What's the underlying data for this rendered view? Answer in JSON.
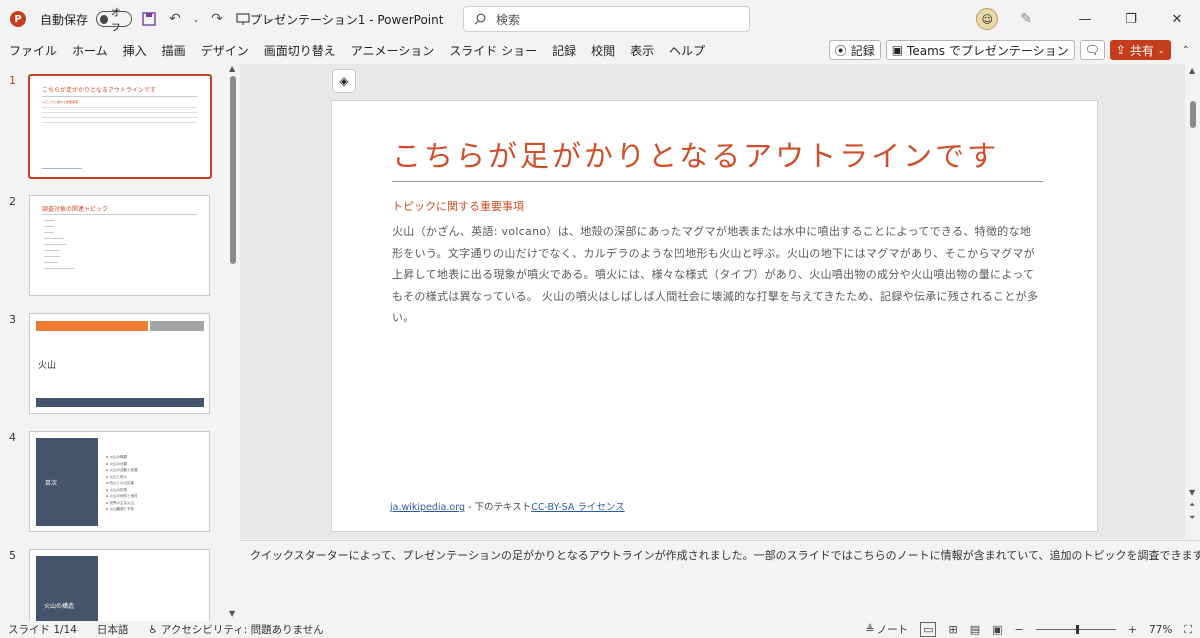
{
  "titlebar": {
    "app_icon": "P",
    "autosave_label": "自動保存",
    "autosave_state": "オフ",
    "document_title": "プレゼンテーション1 - PowerPoint",
    "search_placeholder": "検索"
  },
  "menu": {
    "items": [
      "ファイル",
      "ホーム",
      "挿入",
      "描画",
      "デザイン",
      "画面切り替え",
      "アニメーション",
      "スライド ショー",
      "記録",
      "校閲",
      "表示",
      "ヘルプ"
    ],
    "record_button": "記録",
    "teams_button": "Teams でプレゼンテーション",
    "share_button": "共有"
  },
  "thumbnails": [
    {
      "num": "1",
      "title": "こちらが足がかりとなるアウトラインです",
      "sub": "トピックに関する重要事項"
    },
    {
      "num": "2",
      "title": "調査対象の関連トピック"
    },
    {
      "num": "3",
      "title": "火山"
    },
    {
      "num": "4",
      "title": "目次",
      "items": [
        "火山の概要",
        "火山の分類",
        "火山の活動と危険",
        "火山と噴火",
        "噴火と火山災害",
        "火山の形態",
        "火山の地形と地質",
        "世界の主な火山",
        "火山観測と予知"
      ]
    },
    {
      "num": "5",
      "title": "火山の構造"
    }
  ],
  "slide": {
    "title": "こちらが足がかりとなるアウトラインです",
    "subtitle": "トピックに関する重要事項",
    "body": "火山（かざん、英語: volcano）は、地殻の深部にあったマグマが地表または水中に噴出することによってできる、特徴的な地形をいう。文字通りの山だけでなく、カルデラのような凹地形も火山と呼ぶ。火山の地下にはマグマがあり、そこからマグマが上昇して地表に出る現象が噴火である。噴火には、様々な様式（タイプ）があり、火山噴出物の成分や火山噴出物の量によってもその様式は異なっている。 火山の噴火はしばしば人間社会に壊滅的な打撃を与えてきたため、記録や伝承に残されることが多い。",
    "footer_link1": "ja.wikipedia.org",
    "footer_mid": " - 下のテキスト",
    "footer_link2": "CC-BY-SA ライセンス"
  },
  "notes": {
    "text": "クイックスターターによって、プレゼンテーションの足がかりとなるアウトラインが作成されました。一部のスライドではこちらのノートに情報が含まれていて、追加のトピックを調査できます。"
  },
  "status": {
    "slide_counter": "スライド 1/14",
    "language": "日本語",
    "accessibility": "アクセシビリティ: 問題ありません",
    "notes_button": "ノート",
    "zoom": "77%"
  },
  "colors": {
    "accent": "#c43e1c",
    "title_red": "#d04f2a",
    "thumb3_orange": "#ed7d31",
    "thumb3_gray": "#a5a5a5",
    "dark_slate": "#44546a"
  }
}
